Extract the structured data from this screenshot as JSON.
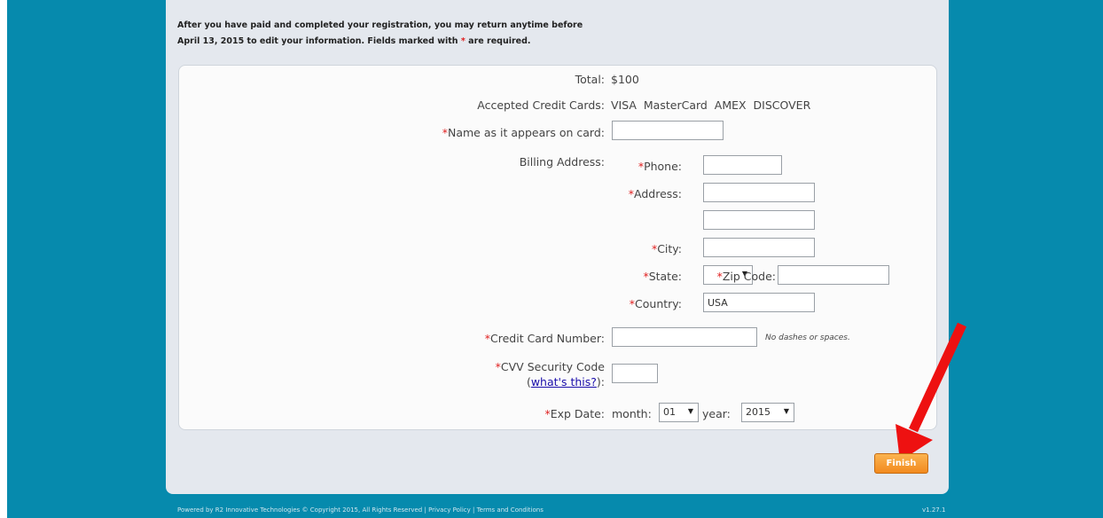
{
  "intro": {
    "line1": "After you have paid and completed your registration, you may return anytime before",
    "line2_pre": "April 13, 2015 to edit your information. Fields marked with ",
    "required_mark": "*",
    "line2_post": " are required."
  },
  "form": {
    "total_label": "Total:",
    "total_value": "$100",
    "cards_label": "Accepted Credit Cards:",
    "cards_value": "VISA  MasterCard  AMEX  DISCOVER",
    "name_label": "Name as it appears on card:",
    "billing_label": "Billing Address:",
    "phone_label": "Phone:",
    "address_label": "Address:",
    "city_label": "City:",
    "state_label": "State:",
    "state_value": "",
    "zip_label": "Zip Code:",
    "country_label": "Country:",
    "country_value": "USA",
    "cc_label": "Credit Card Number:",
    "cc_hint": "No dashes or spaces.",
    "cvv_label": "CVV Security Code",
    "cvv_link_open": "(",
    "cvv_link": "what's this?",
    "cvv_link_close": "):",
    "exp_label": "Exp Date:",
    "month_label": "month:",
    "month_value": "01",
    "year_label": "year:",
    "year_value": "2015"
  },
  "buttons": {
    "finish": "Finish"
  },
  "footer": {
    "text": "Powered by R2 Innovative Technologies © Copyright 2015, All Rights Reserved | Privacy Policy | Terms and Conditions",
    "version": "v1.27.1"
  },
  "colors": {
    "background": "#068aad",
    "accent_orange": "#f28a1e",
    "required": "#e02020",
    "arrow": "#ee1111"
  }
}
